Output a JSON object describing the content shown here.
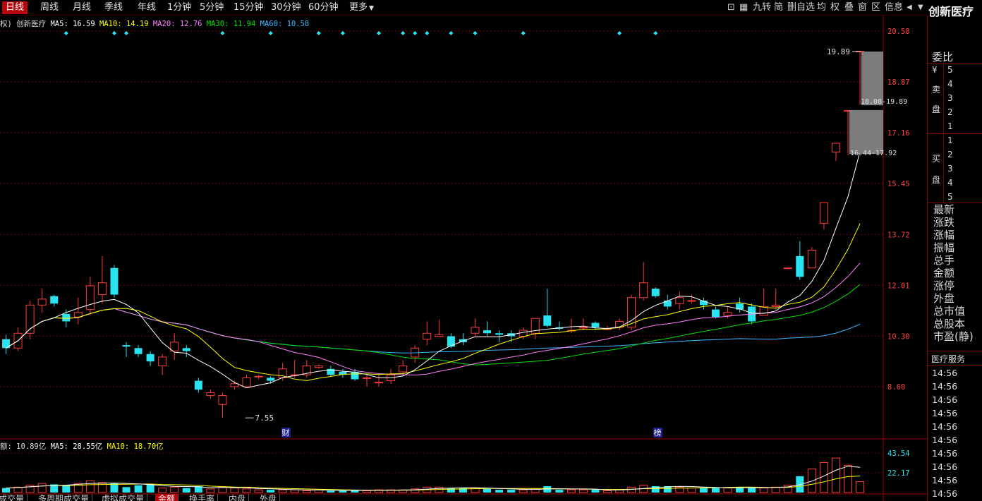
{
  "toolbar": {
    "tabs": [
      "日线",
      "周线",
      "月线",
      "季线",
      "年线",
      "1分钟",
      "5分钟",
      "15分钟",
      "30分钟",
      "60分钟",
      "更多"
    ],
    "active_tab": "日线",
    "right_items": [
      "九转",
      "简",
      "删自选",
      "均",
      "权",
      "叠",
      "窗",
      "区",
      "信息"
    ]
  },
  "stock_name": "创新医疗",
  "ma_legend": {
    "prefix": "权) 创新医疗",
    "ma5": "MA5: 16.59",
    "ma10": "MA10: 14.19",
    "ma20": "MA20: 12.76",
    "ma30": "MA30: 11.94",
    "ma60": "MA60: 10.58"
  },
  "vol_legend": {
    "amount": "额: 10.89亿",
    "ma5": "MA5: 28.55亿",
    "ma10": "MA10: 18.70亿"
  },
  "price_axis": [
    "20.58",
    "18.87",
    "17.16",
    "15.45",
    "13.72",
    "12.01",
    "10.30",
    "8.60"
  ],
  "vol_axis": [
    "43.54",
    "22.17"
  ],
  "annotations": {
    "high": "19.89",
    "low": "7.55",
    "range_top": "18.08-19.89",
    "range_bottom": "16.44-17.92",
    "marker_cai": "财",
    "marker_bang": "榜"
  },
  "colors": {
    "up": "#ff3b3b",
    "down": "#29e3f0",
    "ma5": "#ffffff",
    "ma10": "#ffff00",
    "ma20": "#ff80ff",
    "ma30": "#00e000",
    "ma60": "#3cb8ff",
    "grid": "#7a0000"
  },
  "side_panel": {
    "webi": "委比",
    "sell_label": [
      "卖",
      "盘"
    ],
    "sell_levels": [
      "5",
      "4",
      "3",
      "2",
      "1"
    ],
    "buy_label": [
      "买",
      "盘"
    ],
    "buy_levels": [
      "1",
      "2",
      "3",
      "4",
      "5"
    ],
    "yen": "¥",
    "quote_rows": [
      "最新",
      "涨跌",
      "涨幅",
      "振幅",
      "总手",
      "金额",
      "涨停",
      "外盘",
      "总市值",
      "总股本",
      "市盈(静)"
    ],
    "ticks_header": "医疗服务",
    "tick_times": [
      "14:56",
      "14:56",
      "14:56",
      "14:56",
      "14:56",
      "14:56",
      "14:56",
      "14:56",
      "14:56",
      "14:56"
    ]
  },
  "bottom_tabs": [
    "成交量",
    "多周期成交量",
    "虚拟成交量",
    "金额",
    "换手率",
    "内盘",
    "外盘"
  ],
  "bottom_active": "金额",
  "chart_data": {
    "type": "candlestick",
    "ylim": [
      6.2,
      21.2
    ],
    "candles": [
      [
        10.2,
        9.9,
        10.35,
        9.7
      ],
      [
        9.9,
        10.4,
        10.6,
        9.8
      ],
      [
        10.4,
        11.35,
        11.5,
        10.2
      ],
      [
        11.35,
        11.55,
        11.9,
        11.1
      ],
      [
        11.65,
        11.4,
        11.7,
        11.3
      ],
      [
        11.05,
        10.8,
        11.2,
        10.6
      ],
      [
        10.95,
        11.1,
        11.6,
        10.7
      ],
      [
        11.2,
        12.0,
        12.3,
        11.0
      ],
      [
        11.7,
        12.1,
        13.0,
        11.4
      ],
      [
        12.6,
        11.7,
        12.7,
        11.6
      ],
      [
        10.0,
        9.95,
        10.1,
        9.6
      ],
      [
        9.9,
        9.7,
        10.0,
        9.6
      ],
      [
        9.7,
        9.45,
        9.8,
        9.3
      ],
      [
        9.3,
        9.6,
        9.7,
        9.0
      ],
      [
        9.8,
        10.1,
        10.4,
        9.5
      ],
      [
        9.9,
        9.8,
        10.0,
        9.6
      ],
      [
        8.8,
        8.5,
        8.9,
        8.4
      ],
      [
        8.3,
        8.4,
        8.5,
        8.2
      ],
      [
        8.0,
        8.3,
        8.4,
        7.55
      ],
      [
        8.6,
        8.7,
        8.8,
        8.5
      ],
      [
        8.6,
        8.9,
        9.0,
        8.6
      ],
      [
        8.95,
        8.95,
        9.0,
        8.85
      ],
      [
        8.9,
        8.8,
        8.95,
        8.7
      ],
      [
        8.9,
        9.2,
        9.4,
        8.8
      ],
      [
        9.0,
        9.0,
        9.5,
        8.9
      ],
      [
        9.0,
        9.3,
        9.5,
        8.9
      ],
      [
        9.25,
        9.3,
        9.35,
        9.2
      ],
      [
        9.2,
        9.0,
        9.3,
        8.95
      ],
      [
        9.1,
        9.0,
        9.2,
        8.9
      ],
      [
        9.1,
        8.85,
        9.2,
        8.8
      ],
      [
        8.9,
        8.9,
        9.0,
        8.6
      ],
      [
        8.75,
        8.75,
        9.0,
        8.6
      ],
      [
        8.8,
        9.0,
        9.2,
        8.7
      ],
      [
        9.1,
        9.3,
        9.5,
        9.0
      ],
      [
        9.6,
        9.9,
        10.0,
        9.4
      ],
      [
        10.2,
        10.4,
        10.8,
        10.0
      ],
      [
        10.3,
        10.35,
        10.85,
        10.3
      ],
      [
        10.3,
        9.95,
        10.4,
        9.9
      ],
      [
        10.2,
        10.1,
        10.4,
        10.0
      ],
      [
        10.4,
        10.6,
        10.9,
        10.3
      ],
      [
        10.5,
        10.4,
        10.8,
        10.3
      ],
      [
        10.4,
        10.35,
        10.5,
        10.1
      ],
      [
        10.4,
        10.3,
        10.5,
        10.1
      ],
      [
        10.3,
        10.5,
        10.6,
        10.2
      ],
      [
        10.4,
        10.9,
        10.9,
        10.2
      ],
      [
        11.0,
        10.65,
        11.9,
        10.6
      ],
      [
        10.6,
        10.55,
        10.8,
        10.5
      ],
      [
        10.5,
        10.5,
        10.9,
        10.4
      ],
      [
        10.6,
        10.6,
        10.9,
        10.5
      ],
      [
        10.75,
        10.6,
        10.8,
        10.5
      ],
      [
        10.55,
        10.55,
        10.65,
        10.5
      ],
      [
        10.6,
        10.8,
        10.9,
        10.5
      ],
      [
        10.6,
        11.6,
        11.7,
        10.5
      ],
      [
        11.6,
        12.1,
        12.8,
        11.5
      ],
      [
        11.9,
        11.65,
        11.95,
        11.6
      ],
      [
        11.5,
        11.3,
        11.7,
        11.2
      ],
      [
        11.4,
        11.6,
        11.8,
        11.2
      ],
      [
        11.5,
        11.5,
        11.7,
        11.4
      ],
      [
        11.5,
        11.35,
        11.6,
        11.2
      ],
      [
        11.2,
        10.95,
        11.3,
        10.9
      ],
      [
        11.0,
        11.1,
        11.3,
        10.9
      ],
      [
        11.4,
        11.2,
        11.6,
        11.1
      ],
      [
        11.3,
        10.8,
        11.4,
        10.7
      ],
      [
        11.0,
        11.3,
        11.9,
        11.0
      ],
      [
        11.3,
        11.35,
        11.9,
        11.2
      ],
      [
        12.6,
        12.6,
        12.6,
        12.6
      ],
      [
        13.0,
        12.3,
        13.5,
        12.2
      ],
      [
        12.6,
        13.2,
        13.3,
        12.6
      ],
      [
        14.1,
        14.8,
        14.8,
        13.9
      ],
      [
        16.5,
        16.8,
        16.8,
        16.2
      ],
      [
        17.9,
        17.9,
        17.9,
        16.4
      ],
      [
        19.9,
        19.9,
        19.9,
        18.1
      ]
    ],
    "volume_bars": [
      5,
      6,
      8,
      10,
      9,
      8,
      10,
      13,
      11,
      10,
      6,
      8,
      9,
      5,
      6,
      5,
      7,
      4,
      6,
      5,
      4,
      3,
      3,
      3,
      3,
      2,
      3,
      2,
      2,
      3,
      2,
      3,
      3,
      3,
      4,
      6,
      6,
      5,
      5,
      5,
      4,
      3,
      3,
      3,
      4,
      7,
      3,
      3,
      3,
      3,
      2,
      3,
      6,
      8,
      7,
      7,
      6,
      5,
      5,
      5,
      5,
      6,
      6,
      5,
      6,
      8,
      18,
      26,
      33,
      38,
      30,
      12
    ]
  }
}
